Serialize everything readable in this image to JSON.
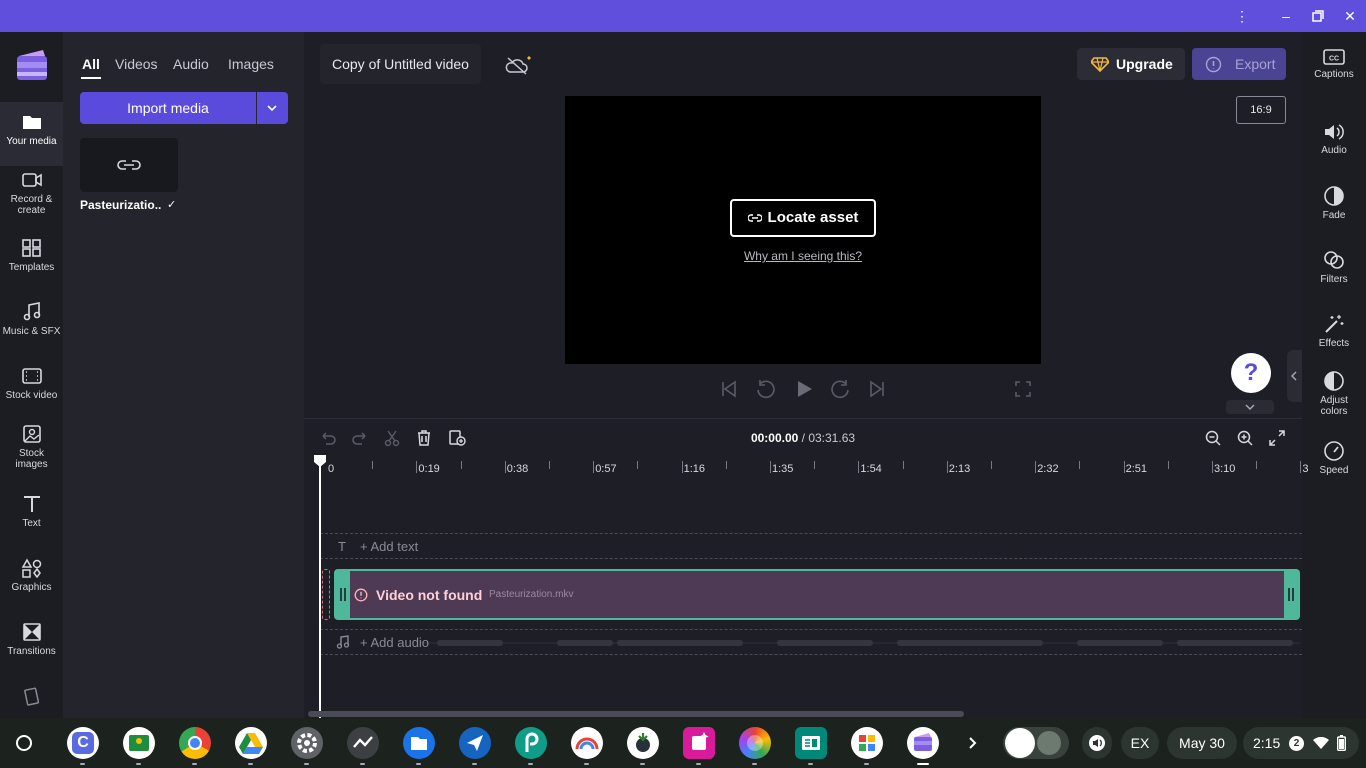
{
  "left_nav": [
    {
      "label": "Your media"
    },
    {
      "label": "Record &\ncreate"
    },
    {
      "label": "Templates"
    },
    {
      "label": "Music & SFX"
    },
    {
      "label": "Stock video"
    },
    {
      "label": "Stock\nimages"
    },
    {
      "label": "Text"
    },
    {
      "label": "Graphics"
    },
    {
      "label": "Transitions"
    }
  ],
  "media": {
    "tabs": [
      "All",
      "Videos",
      "Audio",
      "Images"
    ],
    "import_label": "Import media",
    "item_label": "Pasteurizatio..."
  },
  "header": {
    "project_title": "Copy of Untitled video",
    "upgrade_label": "Upgrade",
    "export_label": "Export",
    "aspect_ratio": "16:9"
  },
  "preview": {
    "locate_label": "Locate asset",
    "why_label": "Why am I seeing this?"
  },
  "right_nav": [
    {
      "label": "Captions"
    },
    {
      "label": "Audio"
    },
    {
      "label": "Fade"
    },
    {
      "label": "Filters"
    },
    {
      "label": "Effects"
    },
    {
      "label": "Adjust\ncolors"
    },
    {
      "label": "Speed"
    }
  ],
  "timeline": {
    "current_time": "00:00.00",
    "total_time": " / 03:31.63",
    "ticks": [
      "0",
      "0:19",
      "0:38",
      "0:57",
      "1:16",
      "1:35",
      "1:54",
      "2:13",
      "2:32",
      "2:51",
      "3:10",
      "3"
    ],
    "add_text_label": "+ Add text",
    "add_audio_label": "+ Add audio",
    "clip_title": "Video not found",
    "clip_file": "Pasteurization.mkv"
  },
  "taskbar": {
    "language": "EX",
    "date": "May 30",
    "time": "2:15",
    "notification_count": "2"
  },
  "colors": {
    "accent": "#5a4bdc",
    "titlebar": "#5f4fdc",
    "clip_border": "#4fb89a",
    "clip_fill": "#4e3a55"
  }
}
